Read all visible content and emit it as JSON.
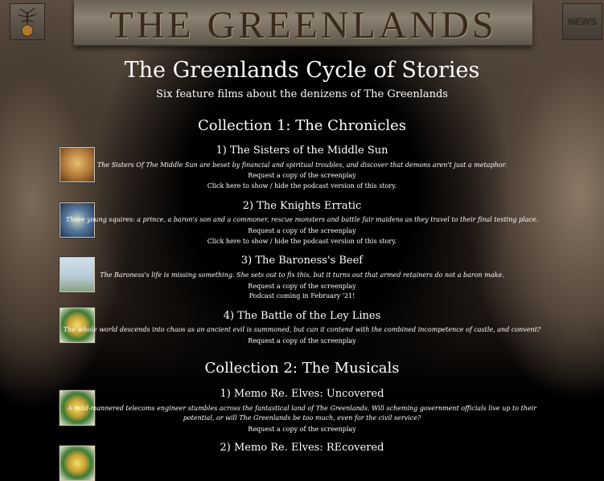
{
  "header": {
    "banner_title": "THE GREENLANDS",
    "news_label": "NEWS"
  },
  "page": {
    "title": "The Greenlands Cycle of Stories",
    "subtitle": "Six feature films about the denizens of The Greenlands"
  },
  "collections": [
    {
      "title": "Collection 1: The Chronicles",
      "stories": [
        {
          "title": "1) The Sisters of the Middle Sun",
          "description": "The Sisters Of The Middle Sun are beset by financial and spiritual troubles, and discover that demons aren't just a metaphor.",
          "request": "Request a copy of the screenplay",
          "extra": "Click here to show / hide the podcast version of this story."
        },
        {
          "title": "2) The Knights Erratic",
          "description": "Three young squires: a prince, a baron's son and a commoner, rescue monsters and battle fair maidens as they travel to their final testing place.",
          "request": "Request a copy of the screenplay",
          "extra": "Click here to show / hide the podcast version of this story."
        },
        {
          "title": "3) The Baroness's Beef",
          "description": "The Baroness's life is missing something. She sets out to fix this, but it turns out that armed retainers do not a baron make.",
          "request": "Request a copy of the screenplay",
          "extra": "Podcast coming in February '21!"
        },
        {
          "title": "4) The Battle of the Ley Lines",
          "description": "The whole world descends into chaos as an ancient evil is summoned, but can it contend with the combined incompetence of castle, and convent?",
          "request": "Request a copy of the screenplay"
        }
      ]
    },
    {
      "title": "Collection 2: The Musicals",
      "stories": [
        {
          "title": "1) Memo Re. Elves: Uncovered",
          "description_line1": "A mild-mannered telecoms engineer stumbles across the fantastical land of The Greenlands. Will scheming government officials live up to their",
          "description_line2": "potential, or will The Greenlands be too much, even for the civil service?",
          "request": "Request a copy of the screenplay"
        },
        {
          "title": "2) Memo Re. Elves: REcovered"
        }
      ]
    }
  ]
}
